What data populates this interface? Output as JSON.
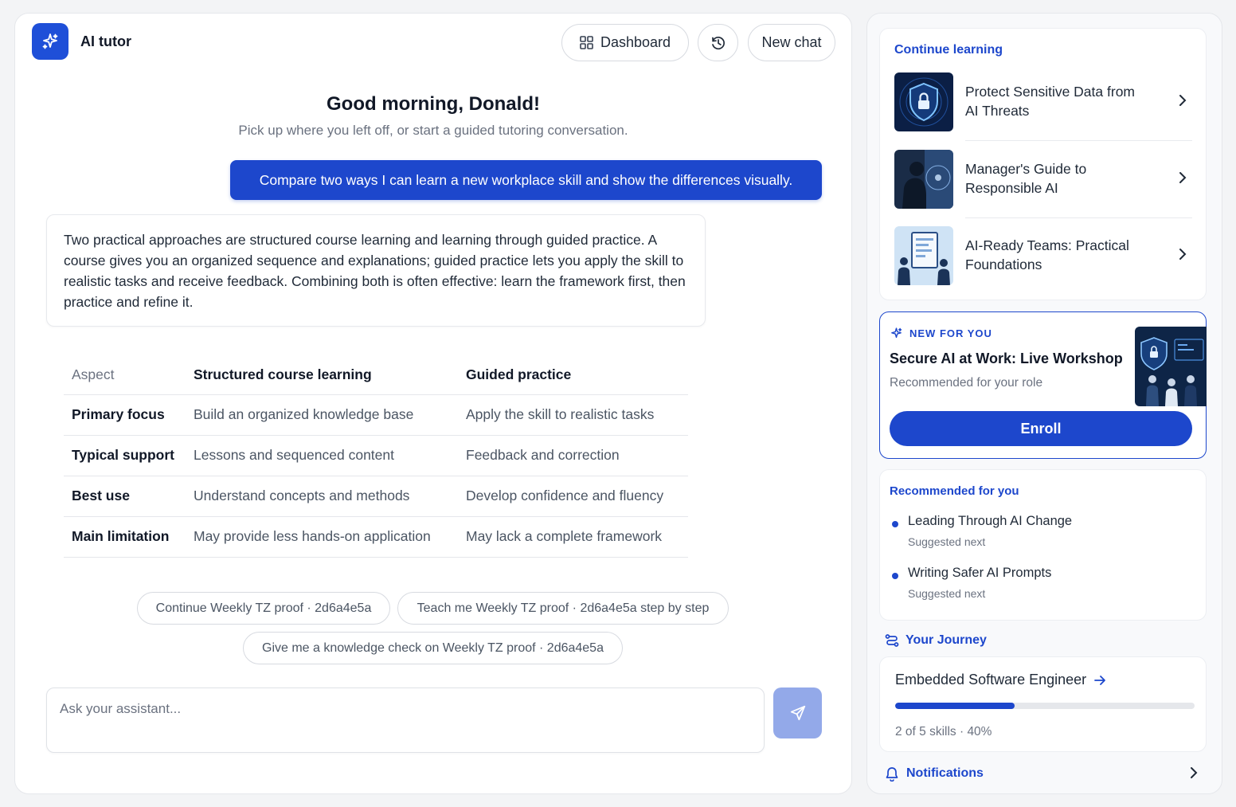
{
  "app": {
    "title": "AI tutor"
  },
  "header": {
    "dashboard_label": "Dashboard",
    "new_chat_label": "New chat"
  },
  "hero": {
    "greeting": "Good morning, Donald!",
    "subtitle": "Pick up where you left off, or start a guided tutoring conversation."
  },
  "chat": {
    "user_message": "Compare two ways I can learn a new workplace skill and show the differences visually.",
    "assistant_message": "Two practical approaches are structured course learning and learning through guided practice. A course gives you an organized sequence and explanations; guided practice lets you apply the skill to realistic tasks and receive feedback. Combining both is often effective: learn the framework first, then practice and refine it."
  },
  "table": {
    "headers": [
      "Aspect",
      "Structured course learning",
      "Guided practice"
    ],
    "rows": [
      [
        "Primary focus",
        "Build an organized knowledge base",
        "Apply the skill to realistic tasks"
      ],
      [
        "Typical support",
        "Lessons and sequenced content",
        "Feedback and correction"
      ],
      [
        "Best use",
        "Understand concepts and methods",
        "Develop confidence and fluency"
      ],
      [
        "Main limitation",
        "May provide less hands-on application",
        "May lack a complete framework"
      ]
    ]
  },
  "suggestions": [
    "Continue Weekly TZ proof · 2d6a4e5a",
    "Teach me Weekly TZ proof · 2d6a4e5a step by step",
    "Give me a knowledge check on Weekly TZ proof · 2d6a4e5a"
  ],
  "composer": {
    "placeholder": "Ask your assistant..."
  },
  "sidebar": {
    "continue_learning": {
      "title": "Continue learning",
      "items": [
        {
          "label": "Protect Sensitive Data from AI Threats"
        },
        {
          "label": "Manager's Guide to Responsible AI"
        },
        {
          "label": "AI-Ready Teams: Practical Foundations"
        }
      ]
    },
    "new_for_you": {
      "tag": "NEW FOR YOU",
      "title": "Secure AI at Work: Live Workshop",
      "subtitle": "Recommended for your role",
      "button": "Enroll"
    },
    "recommended": {
      "title": "Recommended for you",
      "items": [
        {
          "title": "Leading Through AI Change",
          "sub": "Suggested next"
        },
        {
          "title": "Writing Safer AI Prompts",
          "sub": "Suggested next"
        }
      ]
    },
    "journey": {
      "title": "Your Journey",
      "role": "Embedded Software Engineer",
      "progress_text": "2 of 5 skills · 40%",
      "progress_fraction": 0.4
    },
    "notifications": {
      "label": "Notifications"
    }
  },
  "colors": {
    "accent": "#1d47cc",
    "send_disabled": "#93a9e9"
  }
}
